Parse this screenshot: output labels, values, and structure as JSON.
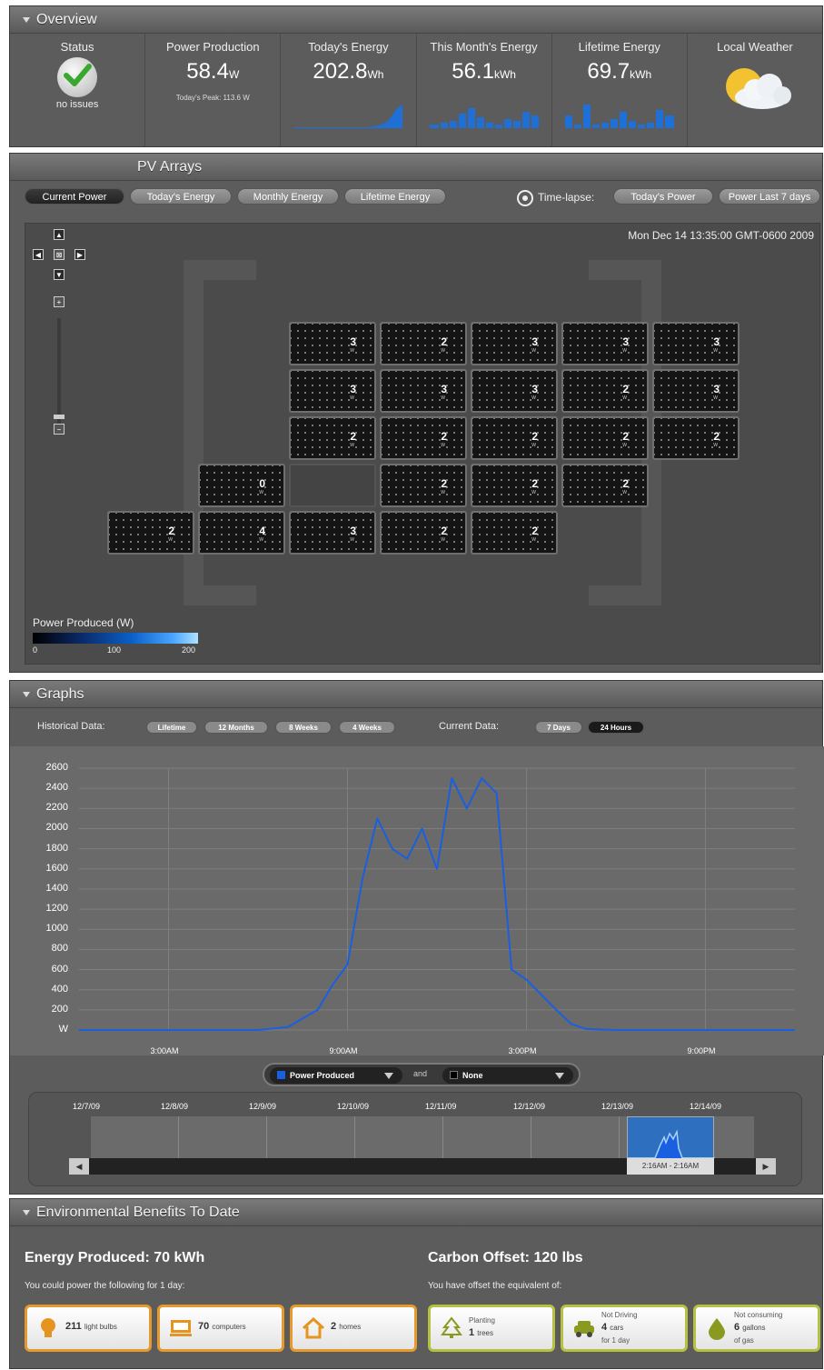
{
  "overview": {
    "title": "Overview",
    "status": {
      "label": "Status",
      "text": "no issues"
    },
    "power_production": {
      "label": "Power Production",
      "value": "58.4",
      "unit": "W",
      "peak": "Today's Peak: 113.6 W"
    },
    "todays_energy": {
      "label": "Today's Energy",
      "value": "202.8",
      "unit": "Wh"
    },
    "month_energy": {
      "label": "This Month's Energy",
      "value": "56.1",
      "unit": "kWh"
    },
    "lifetime_energy": {
      "label": "Lifetime Energy",
      "value": "69.7",
      "unit": "kWh"
    },
    "weather": {
      "label": "Local Weather",
      "icon": "partly-sunny-icon"
    }
  },
  "pv": {
    "title": "PV Arrays",
    "tabs": [
      "Current Power",
      "Today's Energy",
      "Monthly Energy",
      "Lifetime Energy"
    ],
    "timelapse_label": "Time-lapse:",
    "timelapse_tabs": [
      "Today's Power",
      "Power Last 7 days"
    ],
    "timestamp": "Mon Dec 14 13:35:00 GMT-0600 2009",
    "panel_rows": [
      [
        "",
        "",
        "3",
        "2",
        "3",
        "3",
        "3"
      ],
      [
        "",
        "",
        "3",
        "3",
        "3",
        "2",
        "3"
      ],
      [
        "",
        "",
        "2",
        "2",
        "2",
        "2",
        "2"
      ],
      [
        "",
        "0",
        "empty",
        "2",
        "2",
        "2",
        ""
      ],
      [
        "2",
        "4",
        "3",
        "2",
        "2",
        "",
        ""
      ]
    ],
    "panel_unit": "W",
    "legend_title": "Power Produced (W)",
    "legend_ticks": [
      "0",
      "100",
      "200"
    ],
    "colors": {
      "tile_low": "#141414",
      "legend_high": "#aee2ff"
    }
  },
  "graphs": {
    "title": "Graphs",
    "historical_label": "Historical Data:",
    "historical": [
      "Lifetime",
      "12 Months",
      "8 Weeks",
      "4 Weeks"
    ],
    "current_label": "Current Data:",
    "current": [
      "7 Days",
      "24 Hours"
    ],
    "series_a": "Power Produced",
    "and_label": "and",
    "series_b": "None",
    "nav_dates": [
      "12/7/09",
      "12/8/09",
      "12/9/09",
      "12/10/09",
      "12/11/09",
      "12/12/09",
      "12/13/09",
      "12/14/09"
    ],
    "nav_range": "2:16AM - 2:16AM",
    "line_color": "#1a5fe0"
  },
  "chart_data": {
    "type": "line",
    "ylabel": "W",
    "ylim": [
      0,
      2600
    ],
    "yticks": [
      "2600",
      "2400",
      "2200",
      "2000",
      "1800",
      "1600",
      "1400",
      "1200",
      "1000",
      "800",
      "600",
      "400",
      "200",
      "W"
    ],
    "xlim": [
      "12:00AM",
      "12:00AM"
    ],
    "xticks": [
      "3:00AM",
      "9:00AM",
      "3:00PM",
      "9:00PM"
    ],
    "grid": true,
    "series": [
      {
        "name": "Power Produced",
        "x": [
          "12:00AM",
          "6:00AM",
          "7:00AM",
          "8:00AM",
          "8:30AM",
          "9:00AM",
          "9:30AM",
          "10:00AM",
          "10:30AM",
          "11:00AM",
          "11:30AM",
          "12:00PM",
          "12:30PM",
          "1:00PM",
          "1:30PM",
          "2:00PM",
          "2:30PM",
          "3:00PM",
          "3:30PM",
          "4:00PM",
          "4:30PM",
          "5:00PM",
          "6:00PM",
          "11:59PM"
        ],
        "values": [
          0,
          0,
          30,
          200,
          450,
          650,
          1500,
          2100,
          1800,
          1700,
          2000,
          1600,
          2500,
          2200,
          2500,
          2350,
          600,
          500,
          350,
          200,
          60,
          10,
          0,
          0
        ]
      }
    ]
  },
  "env": {
    "title": "Environmental Benefits To Date",
    "energy_title": "Energy Produced: 70 kWh",
    "energy_sub": "You could power the following for 1 day:",
    "carbon_title": "Carbon Offset: 120 lbs",
    "carbon_sub": "You have offset the equivalent of:",
    "bulbs_value": "211",
    "bulbs_name": "light bulbs",
    "computers_value": "70",
    "computers_name": "computers",
    "homes_value": "2",
    "homes_name": "homes",
    "trees_pre": "Planting",
    "trees_value": "1",
    "trees_name": "trees",
    "cars_pre": "Not Driving",
    "cars_value": "4",
    "cars_name": "cars",
    "cars_post": "for 1 day",
    "gas_pre": "Not consuming",
    "gas_value": "6",
    "gas_name": "gallons",
    "gas_post": "of gas"
  }
}
